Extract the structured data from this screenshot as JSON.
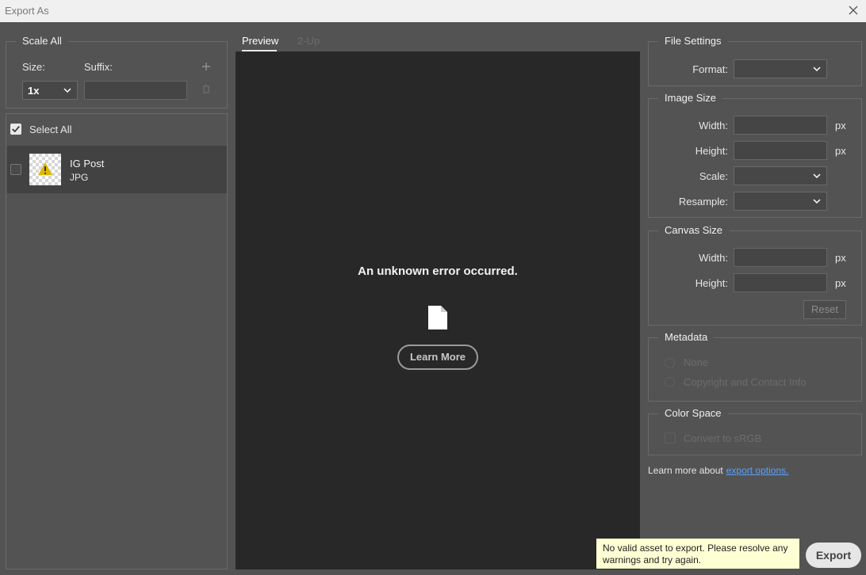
{
  "window": {
    "title": "Export As"
  },
  "scale_all": {
    "legend": "Scale All",
    "size_label": "Size:",
    "suffix_label": "Suffix:",
    "size_value": "1x",
    "suffix_value": "",
    "add_icon": "plus-icon",
    "delete_icon": "trash-icon"
  },
  "assets": {
    "select_all_label": "Select All",
    "select_all_checked": true,
    "items": [
      {
        "name": "IG Post",
        "format": "JPG",
        "checked": false,
        "thumb_icon": "warning-icon"
      }
    ]
  },
  "preview": {
    "tabs": [
      {
        "label": "Preview",
        "active": true
      },
      {
        "label": "2-Up",
        "active": false
      }
    ],
    "error_text": "An unknown error occurred.",
    "error_icon": "document-icon",
    "learn_more_label": "Learn More"
  },
  "file_settings": {
    "legend": "File Settings",
    "format_label": "Format:",
    "format_value": ""
  },
  "image_size": {
    "legend": "Image Size",
    "width_label": "Width:",
    "height_label": "Height:",
    "scale_label": "Scale:",
    "resample_label": "Resample:",
    "unit": "px",
    "width_value": "",
    "height_value": "",
    "scale_value": "",
    "resample_value": ""
  },
  "canvas_size": {
    "legend": "Canvas Size",
    "width_label": "Width:",
    "height_label": "Height:",
    "unit": "px",
    "width_value": "",
    "height_value": "",
    "reset_label": "Reset"
  },
  "metadata": {
    "legend": "Metadata",
    "options": [
      "None",
      "Copyright and Contact Info"
    ]
  },
  "color_space": {
    "legend": "Color Space",
    "convert_label": "Convert to sRGB",
    "convert_checked": false
  },
  "footer": {
    "learn_more_text": "Learn more about",
    "learn_more_link": "export options.",
    "warning_text": "No valid asset to export. Please resolve any warnings and try again.",
    "export_label": "Export"
  },
  "colors": {
    "dialog_bg": "#535353",
    "preview_bg": "#282828",
    "link": "#5aa0ff",
    "warning_bg": "#ffffd4",
    "warning_icon": "#e0b800"
  }
}
